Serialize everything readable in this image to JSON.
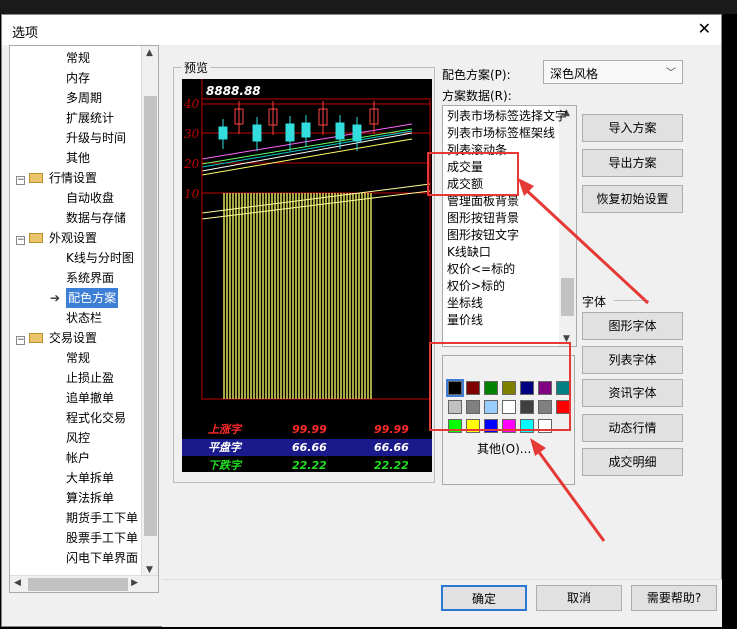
{
  "window": {
    "title": "选项",
    "close_glyph": "✕"
  },
  "tree": {
    "items": [
      {
        "label": "常规",
        "level": 2
      },
      {
        "label": "内存",
        "level": 2
      },
      {
        "label": "多周期",
        "level": 2
      },
      {
        "label": "扩展统计",
        "level": 2
      },
      {
        "label": "升级与时间",
        "level": 2
      },
      {
        "label": "其他",
        "level": 2
      },
      {
        "label": "行情设置",
        "level": 1
      },
      {
        "label": "自动收盘",
        "level": 2
      },
      {
        "label": "数据与存储",
        "level": 2
      },
      {
        "label": "外观设置",
        "level": 1
      },
      {
        "label": "K线与分时图",
        "level": 2
      },
      {
        "label": "系统界面",
        "level": 2
      },
      {
        "label": "配色方案",
        "level": 2,
        "selected": true
      },
      {
        "label": "状态栏",
        "level": 2
      },
      {
        "label": "交易设置",
        "level": 1
      },
      {
        "label": "常规",
        "level": 2
      },
      {
        "label": "止损止盈",
        "level": 2
      },
      {
        "label": "追单撤单",
        "level": 2
      },
      {
        "label": "程式化交易",
        "level": 2
      },
      {
        "label": "风控",
        "level": 2
      },
      {
        "label": "帐户",
        "level": 2
      },
      {
        "label": "大单拆单",
        "level": 2
      },
      {
        "label": "算法拆单",
        "level": 2
      },
      {
        "label": "期货手工下单",
        "level": 2
      },
      {
        "label": "股票手工下单",
        "level": 2
      },
      {
        "label": "闪电下单界面",
        "level": 2
      }
    ]
  },
  "preview": {
    "group_label": "预览",
    "price_label": "8888.88",
    "axis_labels": [
      "40",
      "30",
      "20",
      "10"
    ],
    "rows": [
      {
        "label": "上涨字",
        "v1": "99.99",
        "v2": "99.99",
        "color": "#ff2a2a",
        "bg": "#000000"
      },
      {
        "label": "平盘字",
        "v1": "66.66",
        "v2": "66.66",
        "color": "#ffffff",
        "bg": "#1a1a8c"
      },
      {
        "label": "下跌字",
        "v1": "22.22",
        "v2": "22.22",
        "color": "#22dd22",
        "bg": "#000000"
      }
    ]
  },
  "scheme": {
    "label": "配色方案(P):",
    "selected": "深色风格",
    "data_label": "方案数据(R):",
    "items": [
      "列表市场标签选择文字",
      "列表市场标签框架线",
      "列表滚动条",
      "成交量",
      "成交额",
      "管理面板背景",
      "图形按钮背景",
      "图形按钮文字",
      "K线缺口",
      "权价<=标的",
      "权价>标的",
      "坐标线",
      "量价线"
    ]
  },
  "buttons": {
    "import": "导入方案",
    "export": "导出方案",
    "restore": "恢复初始设置",
    "font_group": "字体",
    "graph_font": "图形字体",
    "list_font": "列表字体",
    "info_font": "资讯字体",
    "dynamic": "动态行情",
    "trade_detail": "成交明细",
    "other": "其他(O)...",
    "ok": "确定",
    "cancel": "取消",
    "help": "需要帮助?"
  },
  "palette": {
    "colors": [
      "#000000",
      "#800000",
      "#008000",
      "#808000",
      "#000080",
      "#800080",
      "#008080",
      "#c0c0c0",
      "#808080",
      "#99ccff",
      "#ffffff",
      "#404040",
      "#808080",
      "#ff0000",
      "#00ff00",
      "#ffff00",
      "#0000ff",
      "#ff00ff",
      "#00ffff",
      "#ffffff"
    ]
  },
  "colors": {
    "selection": "#3d7ed6",
    "annotation": "#e53935"
  }
}
